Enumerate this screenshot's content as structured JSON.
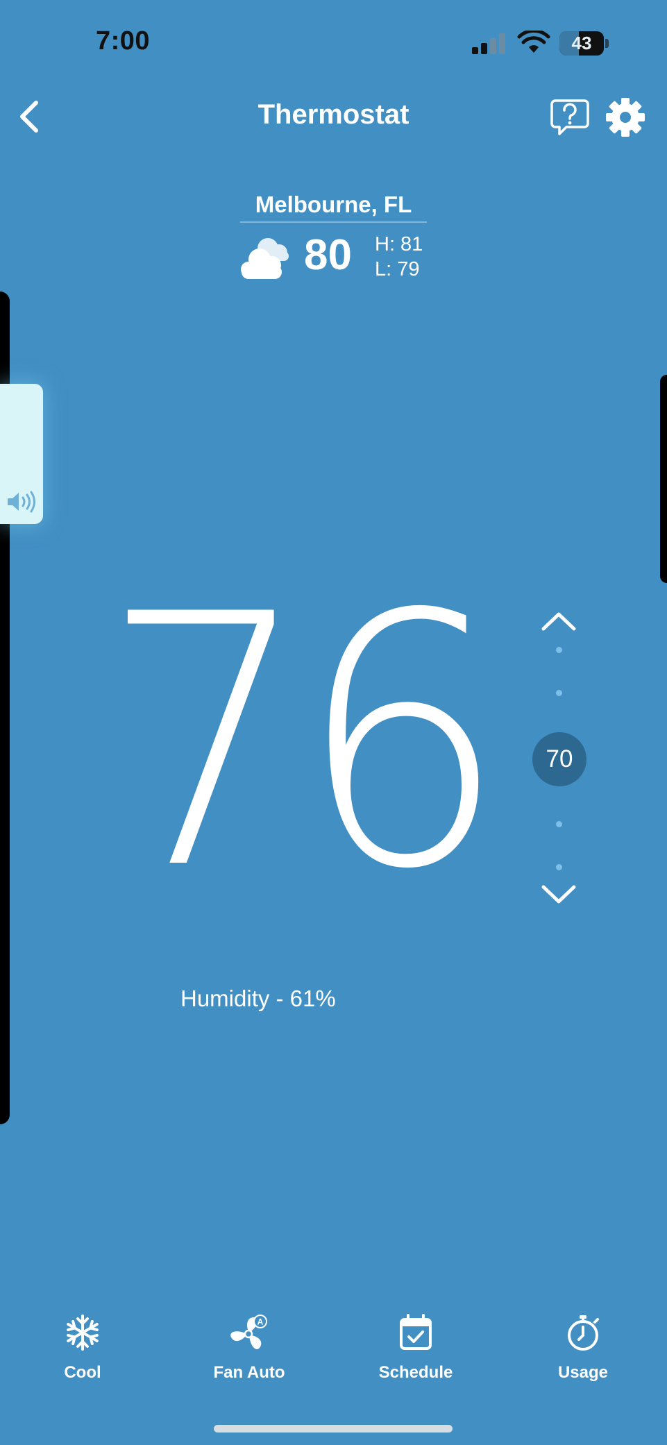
{
  "status_bar": {
    "time": "7:00",
    "battery": "43",
    "icons": [
      "signal-icon",
      "wifi-icon",
      "battery-icon"
    ]
  },
  "nav": {
    "title": "Thermostat",
    "icons": [
      "back-icon",
      "help-icon",
      "gear-icon"
    ]
  },
  "weather": {
    "city": "Melbourne, FL",
    "current_temp": "80",
    "high": "H: 81",
    "low": "L: 79",
    "icon": "cloudy-icon"
  },
  "thermostat": {
    "current_temp": "76",
    "setpoint": "70",
    "humidity": "Humidity - 61%"
  },
  "tabs": [
    {
      "label": "Cool",
      "icon": "snowflake-icon"
    },
    {
      "label": "Fan Auto",
      "icon": "fan-icon"
    },
    {
      "label": "Schedule",
      "icon": "calendar-icon"
    },
    {
      "label": "Usage",
      "icon": "stopwatch-icon"
    }
  ],
  "colors": {
    "background": "#428fc4",
    "setpoint_bubble": "#2c6890",
    "dot": "#7dbfe8",
    "volume_tab": "#d9f5f8"
  }
}
